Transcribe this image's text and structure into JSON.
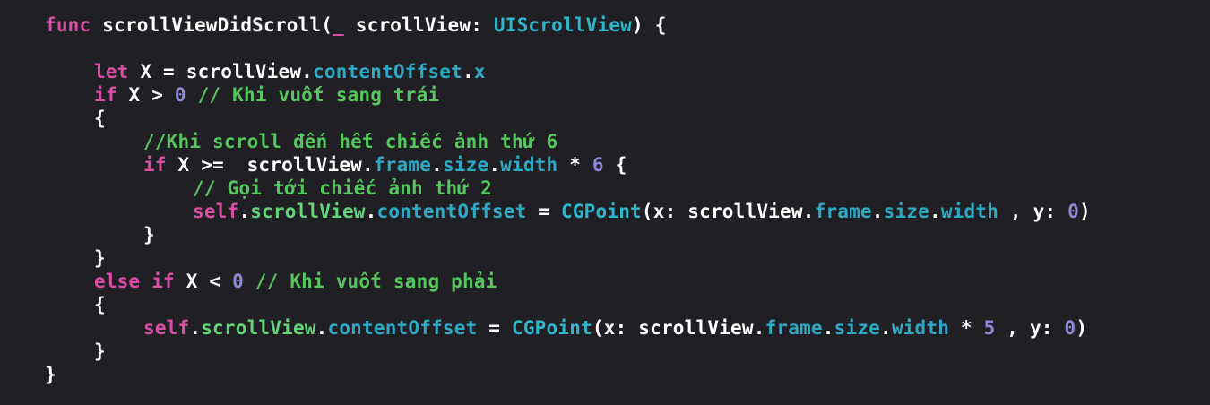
{
  "colors": {
    "background": "#1f1f24",
    "keyword": "#d84fa6",
    "plain": "#ffffff",
    "type": "#2fb6cc",
    "property": "#2fa8c4",
    "member": "#62d47a",
    "number": "#8f88d8",
    "comment": "#57c560"
  },
  "code": {
    "lines": [
      {
        "indent": 0,
        "tokens": [
          {
            "t": "func",
            "c": "keyword"
          },
          {
            "t": " scrollViewDidScroll(",
            "c": "plain"
          },
          {
            "t": "_",
            "c": "keyword"
          },
          {
            "t": " scrollView: ",
            "c": "plain"
          },
          {
            "t": "UIScrollView",
            "c": "type"
          },
          {
            "t": ") {",
            "c": "plain"
          }
        ]
      },
      {
        "indent": 0,
        "tokens": []
      },
      {
        "indent": 1,
        "tokens": [
          {
            "t": "let",
            "c": "keyword"
          },
          {
            "t": " X = scrollView.",
            "c": "plain"
          },
          {
            "t": "contentOffset",
            "c": "property"
          },
          {
            "t": ".",
            "c": "plain"
          },
          {
            "t": "x",
            "c": "property"
          }
        ]
      },
      {
        "indent": 1,
        "tokens": [
          {
            "t": "if",
            "c": "keyword"
          },
          {
            "t": " X > ",
            "c": "plain"
          },
          {
            "t": "0",
            "c": "number"
          },
          {
            "t": " // Khi vuốt sang trái",
            "c": "comment"
          }
        ]
      },
      {
        "indent": 1,
        "tokens": [
          {
            "t": "{",
            "c": "plain"
          }
        ]
      },
      {
        "indent": 2,
        "tokens": [
          {
            "t": "//Khi scroll đến hết chiếc ảnh thứ 6",
            "c": "comment"
          }
        ]
      },
      {
        "indent": 2,
        "tokens": [
          {
            "t": "if",
            "c": "keyword"
          },
          {
            "t": " X >=  scrollView.",
            "c": "plain"
          },
          {
            "t": "frame",
            "c": "property"
          },
          {
            "t": ".",
            "c": "plain"
          },
          {
            "t": "size",
            "c": "property"
          },
          {
            "t": ".",
            "c": "plain"
          },
          {
            "t": "width",
            "c": "property"
          },
          {
            "t": " * ",
            "c": "plain"
          },
          {
            "t": "6",
            "c": "number"
          },
          {
            "t": " {",
            "c": "plain"
          }
        ]
      },
      {
        "indent": 3,
        "tokens": [
          {
            "t": "// Gọi tới chiếc ảnh thứ 2",
            "c": "comment"
          }
        ]
      },
      {
        "indent": 3,
        "tokens": [
          {
            "t": "self",
            "c": "keyword"
          },
          {
            "t": ".",
            "c": "plain"
          },
          {
            "t": "scrollView",
            "c": "member"
          },
          {
            "t": ".",
            "c": "plain"
          },
          {
            "t": "contentOffset",
            "c": "property"
          },
          {
            "t": " = ",
            "c": "plain"
          },
          {
            "t": "CGPoint",
            "c": "type"
          },
          {
            "t": "(x: scrollView.",
            "c": "plain"
          },
          {
            "t": "frame",
            "c": "property"
          },
          {
            "t": ".",
            "c": "plain"
          },
          {
            "t": "size",
            "c": "property"
          },
          {
            "t": ".",
            "c": "plain"
          },
          {
            "t": "width",
            "c": "property"
          },
          {
            "t": " , y: ",
            "c": "plain"
          },
          {
            "t": "0",
            "c": "number"
          },
          {
            "t": ")",
            "c": "plain"
          }
        ]
      },
      {
        "indent": 2,
        "tokens": [
          {
            "t": "}",
            "c": "plain"
          }
        ]
      },
      {
        "indent": 1,
        "tokens": [
          {
            "t": "}",
            "c": "plain"
          }
        ]
      },
      {
        "indent": 1,
        "tokens": [
          {
            "t": "else",
            "c": "keyword"
          },
          {
            "t": " ",
            "c": "plain"
          },
          {
            "t": "if",
            "c": "keyword"
          },
          {
            "t": " X < ",
            "c": "plain"
          },
          {
            "t": "0",
            "c": "number"
          },
          {
            "t": " // Khi vuốt sang phải",
            "c": "comment"
          }
        ]
      },
      {
        "indent": 1,
        "tokens": [
          {
            "t": "{",
            "c": "plain"
          }
        ]
      },
      {
        "indent": 2,
        "tokens": [
          {
            "t": "self",
            "c": "keyword"
          },
          {
            "t": ".",
            "c": "plain"
          },
          {
            "t": "scrollView",
            "c": "member"
          },
          {
            "t": ".",
            "c": "plain"
          },
          {
            "t": "contentOffset",
            "c": "property"
          },
          {
            "t": " = ",
            "c": "plain"
          },
          {
            "t": "CGPoint",
            "c": "type"
          },
          {
            "t": "(x: scrollView.",
            "c": "plain"
          },
          {
            "t": "frame",
            "c": "property"
          },
          {
            "t": ".",
            "c": "plain"
          },
          {
            "t": "size",
            "c": "property"
          },
          {
            "t": ".",
            "c": "plain"
          },
          {
            "t": "width",
            "c": "property"
          },
          {
            "t": " * ",
            "c": "plain"
          },
          {
            "t": "5",
            "c": "number"
          },
          {
            "t": " , y: ",
            "c": "plain"
          },
          {
            "t": "0",
            "c": "number"
          },
          {
            "t": ")",
            "c": "plain"
          }
        ]
      },
      {
        "indent": 1,
        "tokens": [
          {
            "t": "}",
            "c": "plain"
          }
        ]
      },
      {
        "indent": 0,
        "tokens": [
          {
            "t": "}",
            "c": "plain"
          }
        ]
      }
    ]
  }
}
